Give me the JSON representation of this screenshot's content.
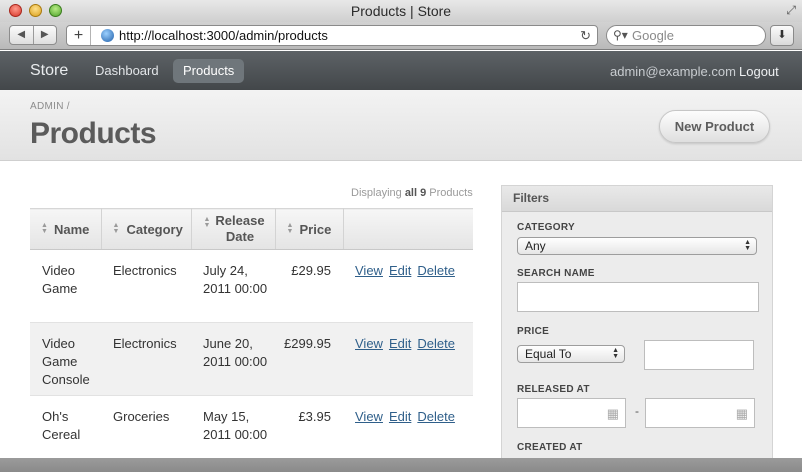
{
  "browser": {
    "window_title": "Products | Store",
    "url": "http://localhost:3000/admin/products",
    "search_placeholder": "Google"
  },
  "navbar": {
    "brand": "Store",
    "links": [
      "Dashboard",
      "Products"
    ],
    "active_link": "Products",
    "user_email": "admin@example.com",
    "logout": "Logout"
  },
  "header": {
    "breadcrumb": "ADMIN /",
    "title": "Products",
    "new_button": "New Product"
  },
  "listing": {
    "displaying_prefix": "Displaying",
    "displaying_count": "all 9",
    "displaying_suffix": "Products",
    "columns": [
      "Name",
      "Category",
      "Release Date",
      "Price"
    ],
    "rows": [
      {
        "name": "Video Game",
        "category": "Electronics",
        "release_date": "July 24, 2011 00:00",
        "price": "£29.95"
      },
      {
        "name": "Video Game Console",
        "category": "Electronics",
        "release_date": "June 20, 2011 00:00",
        "price": "£299.95"
      },
      {
        "name": "Oh's Cereal",
        "category": "Groceries",
        "release_date": "May 15, 2011 00:00",
        "price": "£3.95"
      }
    ],
    "actions": [
      "View",
      "Edit",
      "Delete"
    ]
  },
  "filters": {
    "title": "Filters",
    "category_label": "CATEGORY",
    "category_value": "Any",
    "search_name_label": "SEARCH NAME",
    "price_label": "PRICE",
    "price_operator": "Equal To",
    "released_at_label": "RELEASED AT",
    "range_separator": "-",
    "created_at_label": "CREATED AT"
  }
}
